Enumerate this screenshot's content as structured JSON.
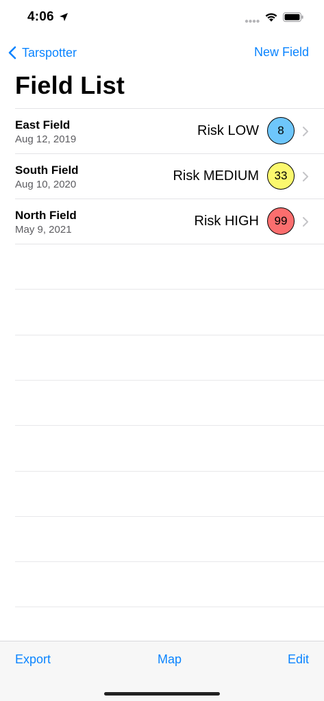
{
  "status_bar": {
    "time": "4:06",
    "icons": [
      "location-arrow-icon",
      "cellular-dots-icon",
      "wifi-icon",
      "battery-icon"
    ]
  },
  "nav": {
    "back_label": "Tarspotter",
    "right_label": "New Field",
    "title": "Field List"
  },
  "fields": [
    {
      "name": "East Field",
      "date": "Aug 12, 2019",
      "risk": "Risk LOW",
      "score": "8",
      "color": "#6ec6fb"
    },
    {
      "name": "South Field",
      "date": "Aug 10, 2020",
      "risk": "Risk MEDIUM",
      "score": "33",
      "color": "#fbf86e"
    },
    {
      "name": "North Field",
      "date": "May 9, 2021",
      "risk": "Risk HIGH",
      "score": "99",
      "color": "#fb6e6e"
    }
  ],
  "toolbar": {
    "export_label": "Export",
    "map_label": "Map",
    "edit_label": "Edit"
  },
  "colors": {
    "accent": "#0a84ff",
    "separator": "#e3e3e6",
    "toolbar_bg": "#f7f7f7"
  }
}
